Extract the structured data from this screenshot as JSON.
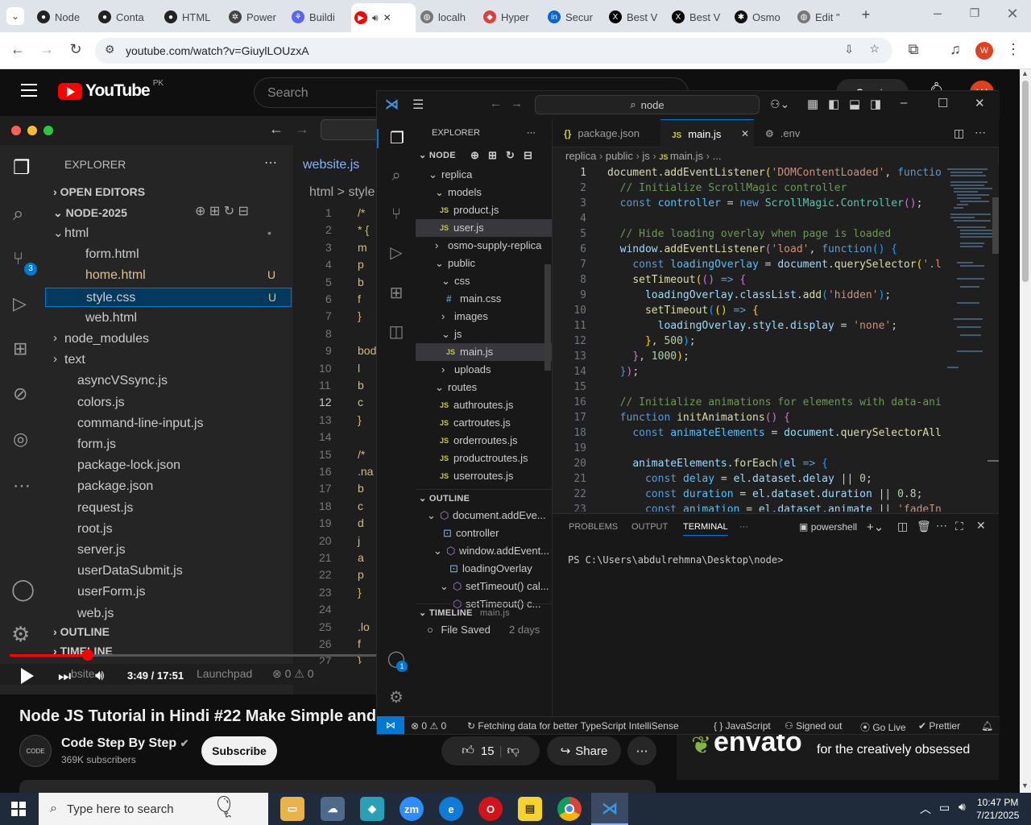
{
  "browser": {
    "tabs": [
      {
        "label": "Node",
        "icon": "github-icon"
      },
      {
        "label": "Conta",
        "icon": "github-icon"
      },
      {
        "label": "HTML",
        "icon": "github-icon"
      },
      {
        "label": "Power",
        "icon": "chatgpt-icon"
      },
      {
        "label": "Buildi",
        "icon": "app-icon"
      },
      {
        "label": "",
        "icon": "youtube-icon"
      },
      {
        "label": "localh",
        "icon": "globe-icon"
      },
      {
        "label": "Hyper",
        "icon": "diamond-icon"
      },
      {
        "label": "Secur",
        "icon": "linkedin-icon"
      },
      {
        "label": "Best V",
        "icon": "x-icon"
      },
      {
        "label": "Best V",
        "icon": "x-icon"
      },
      {
        "label": "Osmo",
        "icon": "site-icon"
      },
      {
        "label": "Edit \"",
        "icon": "globe-icon"
      }
    ],
    "url": "youtube.com/watch?v=GiuylLOUzxA",
    "profile_initial": "W"
  },
  "youtube": {
    "logo": "YouTube",
    "region": "PK",
    "search_placeholder": "Search",
    "create_label": "Create",
    "avatar_initial": "W",
    "time_current_total": "3:49 / 17:51",
    "title": "Node JS Tutorial in Hindi #22 Make Simple and Ba",
    "channel": "Code Step By Step",
    "subscribers": "369K subscribers",
    "subscribe": "Subscribe",
    "likes": "15",
    "share": "Share",
    "envato_logo": "envato",
    "envato_tagline": "for the creatively obsessed",
    "progress_fraction": 0.213
  },
  "video_vscode": {
    "explorer": "EXPLORER",
    "open_editors": "OPEN EDITORS",
    "root": "NODE-2025",
    "items": [
      {
        "label": "html",
        "badge": "•"
      },
      {
        "label": "form.html",
        "badge": ""
      },
      {
        "label": "home.html",
        "badge": "U"
      },
      {
        "label": "style.css",
        "badge": "U"
      },
      {
        "label": "web.html",
        "badge": ""
      },
      {
        "label": "node_modules",
        "badge": ""
      },
      {
        "label": "text",
        "badge": ""
      },
      {
        "label": "asyncVSsync.js",
        "badge": ""
      },
      {
        "label": "colors.js",
        "badge": ""
      },
      {
        "label": "command-line-input.js",
        "badge": ""
      },
      {
        "label": "form.js",
        "badge": ""
      },
      {
        "label": "package-lock.json",
        "badge": ""
      },
      {
        "label": "package.json",
        "badge": ""
      },
      {
        "label": "request.js",
        "badge": ""
      },
      {
        "label": "root.js",
        "badge": ""
      },
      {
        "label": "server.js",
        "badge": ""
      },
      {
        "label": "userDataSubmit.js",
        "badge": ""
      },
      {
        "label": "userForm.js",
        "badge": ""
      },
      {
        "label": "web.js",
        "badge": ""
      }
    ],
    "outline": "OUTLINE",
    "timeline": "TIMELINE",
    "tab": "website.js",
    "breadcrumb": "html > style",
    "status_launchpad": "Launchpad",
    "status_errors": "⊗ 0 ⚠ 0",
    "scm_badge": "3",
    "status_site": "bsite",
    "code_lines": [
      "/*",
      "* {",
      "m",
      "p",
      "b",
      "f",
      "}",
      "",
      "bod",
      "l",
      "b",
      "c",
      "}",
      "",
      "/*",
      ".na",
      "b",
      "c",
      "d",
      "j",
      "a",
      "p",
      "}",
      "",
      ".lo",
      "f",
      "}"
    ]
  },
  "vscode": {
    "command_center": "node",
    "explorer_title": "EXPLORER",
    "root": "NODE",
    "tree": [
      {
        "label": "replica",
        "type": "folder"
      },
      {
        "label": "models",
        "type": "folder"
      },
      {
        "label": "product.js",
        "type": "js"
      },
      {
        "label": "user.js",
        "type": "js"
      },
      {
        "label": "osmo-supply-replica",
        "type": "folder"
      },
      {
        "label": "public",
        "type": "folder"
      },
      {
        "label": "css",
        "type": "folder"
      },
      {
        "label": "main.css",
        "type": "css"
      },
      {
        "label": "images",
        "type": "folder"
      },
      {
        "label": "js",
        "type": "folder"
      },
      {
        "label": "main.js",
        "type": "js"
      },
      {
        "label": "uploads",
        "type": "folder"
      },
      {
        "label": "routes",
        "type": "folder"
      },
      {
        "label": "authroutes.js",
        "type": "js"
      },
      {
        "label": "cartroutes.js",
        "type": "js"
      },
      {
        "label": "orderroutes.js",
        "type": "js"
      },
      {
        "label": "productroutes.js",
        "type": "js"
      },
      {
        "label": "userroutes.js",
        "type": "js"
      }
    ],
    "outline_title": "OUTLINE",
    "outline": [
      {
        "label": "document.addEve..."
      },
      {
        "label": "controller"
      },
      {
        "label": "window.addEvent..."
      },
      {
        "label": "loadingOverlay"
      },
      {
        "label": "setTimeout() cal..."
      },
      {
        "label": "setTimeout() c..."
      }
    ],
    "timeline_title": "TIMELINE",
    "timeline_file": "main.js",
    "timeline_entry": "File Saved",
    "timeline_age": "2 days",
    "tabs": [
      {
        "label": "package.json",
        "icon": "{}"
      },
      {
        "label": "main.js",
        "icon": "JS"
      },
      {
        "label": ".env",
        "icon": "⚙"
      }
    ],
    "breadcrumb": [
      "replica",
      "public",
      "js",
      "main.js",
      "..."
    ],
    "account_badge": "1",
    "code": [
      [
        [
          "fn",
          "document"
        ],
        [
          "",
          "."
        ],
        [
          "fn",
          "addEventListener"
        ],
        [
          "br1",
          "("
        ],
        [
          "str",
          "'DOMContentLoaded'"
        ],
        [
          "",
          ", "
        ],
        [
          "kw",
          "functio"
        ]
      ],
      [
        [
          "",
          "  "
        ],
        [
          "cm",
          "// Initialize ScrollMagic controller"
        ]
      ],
      [
        [
          "",
          "  "
        ],
        [
          "kw",
          "const "
        ],
        [
          "cv",
          "controller"
        ],
        [
          "",
          " = "
        ],
        [
          "kw",
          "new "
        ],
        [
          "cls",
          "ScrollMagic"
        ],
        [
          "",
          "."
        ],
        [
          "cls",
          "Controller"
        ],
        [
          "br2",
          "()"
        ],
        [
          "",
          ";"
        ]
      ],
      [
        [
          "",
          ""
        ]
      ],
      [
        [
          "",
          "  "
        ],
        [
          "cm",
          "// Hide loading overlay when page is loaded"
        ]
      ],
      [
        [
          "",
          "  "
        ],
        [
          "vr",
          "window"
        ],
        [
          "",
          "."
        ],
        [
          "fn",
          "addEventListener"
        ],
        [
          "br2",
          "("
        ],
        [
          "str",
          "'load'"
        ],
        [
          "",
          ", "
        ],
        [
          "kw",
          "function"
        ],
        [
          "br3",
          "()"
        ],
        [
          "",
          " "
        ],
        [
          "br3",
          "{"
        ]
      ],
      [
        [
          "",
          "    "
        ],
        [
          "kw",
          "const "
        ],
        [
          "cv",
          "loadingOverlay"
        ],
        [
          "",
          " = "
        ],
        [
          "vr",
          "document"
        ],
        [
          "",
          "."
        ],
        [
          "fn",
          "querySelector"
        ],
        [
          "br1",
          "("
        ],
        [
          "str",
          "'.l"
        ]
      ],
      [
        [
          "",
          "    "
        ],
        [
          "fn",
          "setTimeout"
        ],
        [
          "br1",
          "("
        ],
        [
          "br2",
          "()"
        ],
        [
          "kw",
          " =>"
        ],
        [
          "",
          " "
        ],
        [
          "br2",
          "{"
        ]
      ],
      [
        [
          "",
          "      "
        ],
        [
          "vr",
          "loadingOverlay"
        ],
        [
          "",
          "."
        ],
        [
          "vr",
          "classList"
        ],
        [
          "",
          "."
        ],
        [
          "fn",
          "add"
        ],
        [
          "br3",
          "("
        ],
        [
          "str",
          "'hidden'"
        ],
        [
          "br3",
          ")"
        ],
        [
          "",
          ";"
        ]
      ],
      [
        [
          "",
          "      "
        ],
        [
          "fn",
          "setTimeout"
        ],
        [
          "br3",
          "("
        ],
        [
          "br1",
          "()"
        ],
        [
          "kw",
          " =>"
        ],
        [
          "",
          " "
        ],
        [
          "br1",
          "{"
        ]
      ],
      [
        [
          "",
          "        "
        ],
        [
          "vr",
          "loadingOverlay"
        ],
        [
          "",
          "."
        ],
        [
          "vr",
          "style"
        ],
        [
          "",
          "."
        ],
        [
          "vr",
          "display"
        ],
        [
          "",
          " = "
        ],
        [
          "str",
          "'none'"
        ],
        [
          "",
          ";"
        ]
      ],
      [
        [
          "",
          "      "
        ],
        [
          "br1",
          "}"
        ],
        [
          "",
          ", "
        ],
        [
          "num",
          "500"
        ],
        [
          "br3",
          ")"
        ],
        [
          "",
          ";"
        ]
      ],
      [
        [
          "",
          "    "
        ],
        [
          "br2",
          "}"
        ],
        [
          "",
          ", "
        ],
        [
          "num",
          "1000"
        ],
        [
          "br1",
          ")"
        ],
        [
          "",
          ";"
        ]
      ],
      [
        [
          "",
          "  "
        ],
        [
          "br3",
          "}"
        ],
        [
          "br2",
          ")"
        ],
        [
          "",
          ";"
        ]
      ],
      [
        [
          "",
          ""
        ]
      ],
      [
        [
          "",
          "  "
        ],
        [
          "cm",
          "// Initialize animations for elements with data-ani"
        ]
      ],
      [
        [
          "",
          "  "
        ],
        [
          "kw",
          "function "
        ],
        [
          "fn",
          "initAnimations"
        ],
        [
          "br2",
          "()"
        ],
        [
          "",
          " "
        ],
        [
          "br2",
          "{"
        ]
      ],
      [
        [
          "",
          "    "
        ],
        [
          "kw",
          "const "
        ],
        [
          "cv",
          "animateElements"
        ],
        [
          "",
          " = "
        ],
        [
          "vr",
          "document"
        ],
        [
          "",
          "."
        ],
        [
          "fn",
          "querySelectorAll"
        ]
      ],
      [
        [
          "",
          ""
        ]
      ],
      [
        [
          "",
          "    "
        ],
        [
          "vr",
          "animateElements"
        ],
        [
          "",
          "."
        ],
        [
          "fn",
          "forEach"
        ],
        [
          "br3",
          "("
        ],
        [
          "vr",
          "el"
        ],
        [
          "kw",
          " =>"
        ],
        [
          "",
          " "
        ],
        [
          "br3",
          "{"
        ]
      ],
      [
        [
          "",
          "      "
        ],
        [
          "kw",
          "const "
        ],
        [
          "cv",
          "delay"
        ],
        [
          "",
          " = "
        ],
        [
          "vr",
          "el"
        ],
        [
          "",
          "."
        ],
        [
          "vr",
          "dataset"
        ],
        [
          "",
          "."
        ],
        [
          "vr",
          "delay"
        ],
        [
          "",
          " || "
        ],
        [
          "num",
          "0"
        ],
        [
          "",
          ";"
        ]
      ],
      [
        [
          "",
          "      "
        ],
        [
          "kw",
          "const "
        ],
        [
          "cv",
          "duration"
        ],
        [
          "",
          " = "
        ],
        [
          "vr",
          "el"
        ],
        [
          "",
          "."
        ],
        [
          "vr",
          "dataset"
        ],
        [
          "",
          "."
        ],
        [
          "vr",
          "duration"
        ],
        [
          "",
          " || "
        ],
        [
          "num",
          "0.8"
        ],
        [
          "",
          ";"
        ]
      ],
      [
        [
          "",
          "      "
        ],
        [
          "kw",
          "const "
        ],
        [
          "cv",
          "animation"
        ],
        [
          "",
          " = "
        ],
        [
          "vr",
          "el"
        ],
        [
          "",
          "."
        ],
        [
          "vr",
          "dataset"
        ],
        [
          "",
          "."
        ],
        [
          "vr",
          "animate"
        ],
        [
          "",
          " || "
        ],
        [
          "str",
          "'fadeIn"
        ]
      ]
    ],
    "panel_tabs": [
      "PROBLEMS",
      "OUTPUT",
      "TERMINAL",
      "···"
    ],
    "shell": "powershell",
    "terminal_prompt": "PS C:\\Users\\abdulrehmna\\Desktop\\node>",
    "status": {
      "errors": "⊗ 0 ⚠ 0",
      "message": "Fetching data for better TypeScript IntelliSense",
      "language": "{ } JavaScript",
      "signed_out": "Signed out",
      "golive": "Go Live",
      "prettier": "Prettier"
    }
  },
  "taskbar": {
    "search_placeholder": "Type here to search",
    "time": "10:47 PM",
    "date": "7/21/2025"
  }
}
